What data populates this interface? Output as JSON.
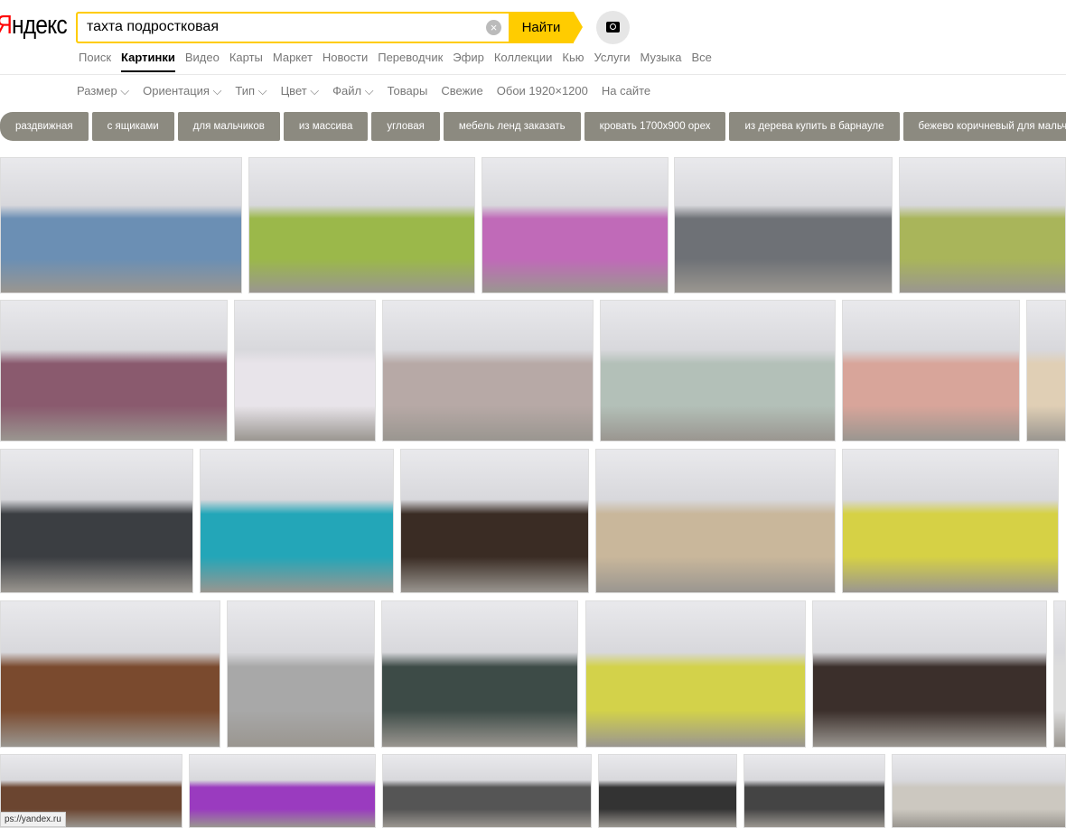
{
  "logo": {
    "first": "Я",
    "rest": "ндекс"
  },
  "search": {
    "value": "тахта подростковая",
    "button": "Найти"
  },
  "nav": [
    {
      "label": "Поиск"
    },
    {
      "label": "Картинки",
      "active": true
    },
    {
      "label": "Видео"
    },
    {
      "label": "Карты"
    },
    {
      "label": "Маркет"
    },
    {
      "label": "Новости"
    },
    {
      "label": "Переводчик"
    },
    {
      "label": "Эфир"
    },
    {
      "label": "Коллекции"
    },
    {
      "label": "Кью"
    },
    {
      "label": "Услуги"
    },
    {
      "label": "Музыка"
    },
    {
      "label": "Все"
    }
  ],
  "filters": [
    "Размер ⌵",
    "Ориентация ⌵",
    "Тип ⌵",
    "Цвет ⌵",
    "Файл ⌵",
    "Товары",
    "Свежие",
    "Обои 1920×1200",
    "На сайте"
  ],
  "chips": [
    "раздвижная",
    "с ящиками",
    "для мальчиков",
    "из массива",
    "угловая",
    "мебель ленд заказать",
    "кровать 1700х900 орех",
    "из дерева купить в барнауле",
    "бежево коричневый для мальчика"
  ],
  "image_colors": [
    [
      "#6b8fb4",
      "#9bb84a",
      "#c06ab8",
      "#6e7176",
      "#a9b55a"
    ],
    [
      "#8a5a6e",
      "#e8e4ea",
      "#b7a9a6",
      "#b3c0b8",
      "#d8a59a",
      "#e0cfb5"
    ],
    [
      "#3b3e42",
      "#23a6b8",
      "#3a2c24",
      "#c9b79b",
      "#d6d145"
    ],
    [
      "#7a4a2e",
      "#a8a8a8",
      "#3d4b47",
      "#d3d24a",
      "#3b2f2b",
      "#ddd"
    ],
    [
      "#6b4530",
      "#9a3bbf",
      "#555",
      "#333",
      "#444",
      "#ccc8c0"
    ]
  ],
  "status_url": "ps://yandex.ru"
}
